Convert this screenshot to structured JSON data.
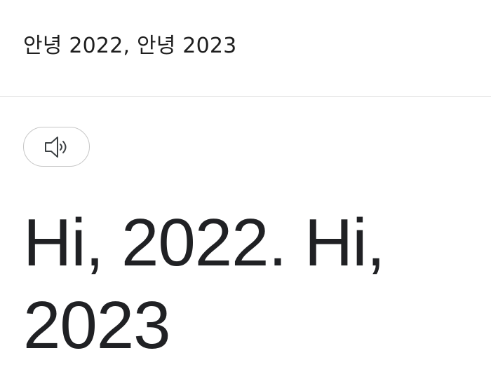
{
  "source": {
    "text": "안녕 2022, 안녕 2023"
  },
  "listen_button": {
    "icon": "speaker-icon"
  },
  "translation": {
    "text": "Hi, 2022. Hi, 2023"
  }
}
